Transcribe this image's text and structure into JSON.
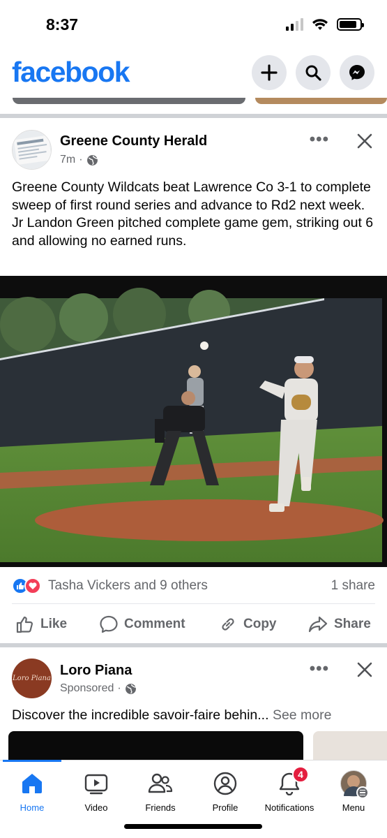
{
  "status": {
    "time": "8:37"
  },
  "header": {
    "logo": "facebook",
    "icons": [
      "plus-icon",
      "search-icon",
      "messenger-icon"
    ]
  },
  "post": {
    "page_name": "Greene County Herald",
    "time": "7m",
    "privacy_icon": "globe-icon",
    "text": "Greene County Wildcats beat Lawrence Co 3-1 to complete sweep of first round series and advance to Rd2 next week. Jr Landon Green pitched complete game gem, striking out 6 and allowing no earned runs.",
    "reactions_text": "Tasha Vickers and 9 others",
    "shares": "1 share",
    "actions": {
      "like": "Like",
      "comment": "Comment",
      "copy": "Copy",
      "share": "Share"
    }
  },
  "ad": {
    "name": "Loro Piana",
    "sponsored": "Sponsored",
    "text": "Discover the incredible savoir-faire behin...",
    "see_more": "See more"
  },
  "nav": {
    "items": [
      {
        "label": "Home",
        "icon": "home-icon"
      },
      {
        "label": "Video",
        "icon": "video-icon"
      },
      {
        "label": "Friends",
        "icon": "friends-icon"
      },
      {
        "label": "Profile",
        "icon": "profile-icon"
      },
      {
        "label": "Notifications",
        "icon": "bell-icon"
      },
      {
        "label": "Menu",
        "icon": "menu-icon"
      }
    ],
    "notifications_badge": "4"
  },
  "colors": {
    "brand": "#1877f2",
    "muted": "#65676b",
    "badge": "#e41e3f"
  }
}
